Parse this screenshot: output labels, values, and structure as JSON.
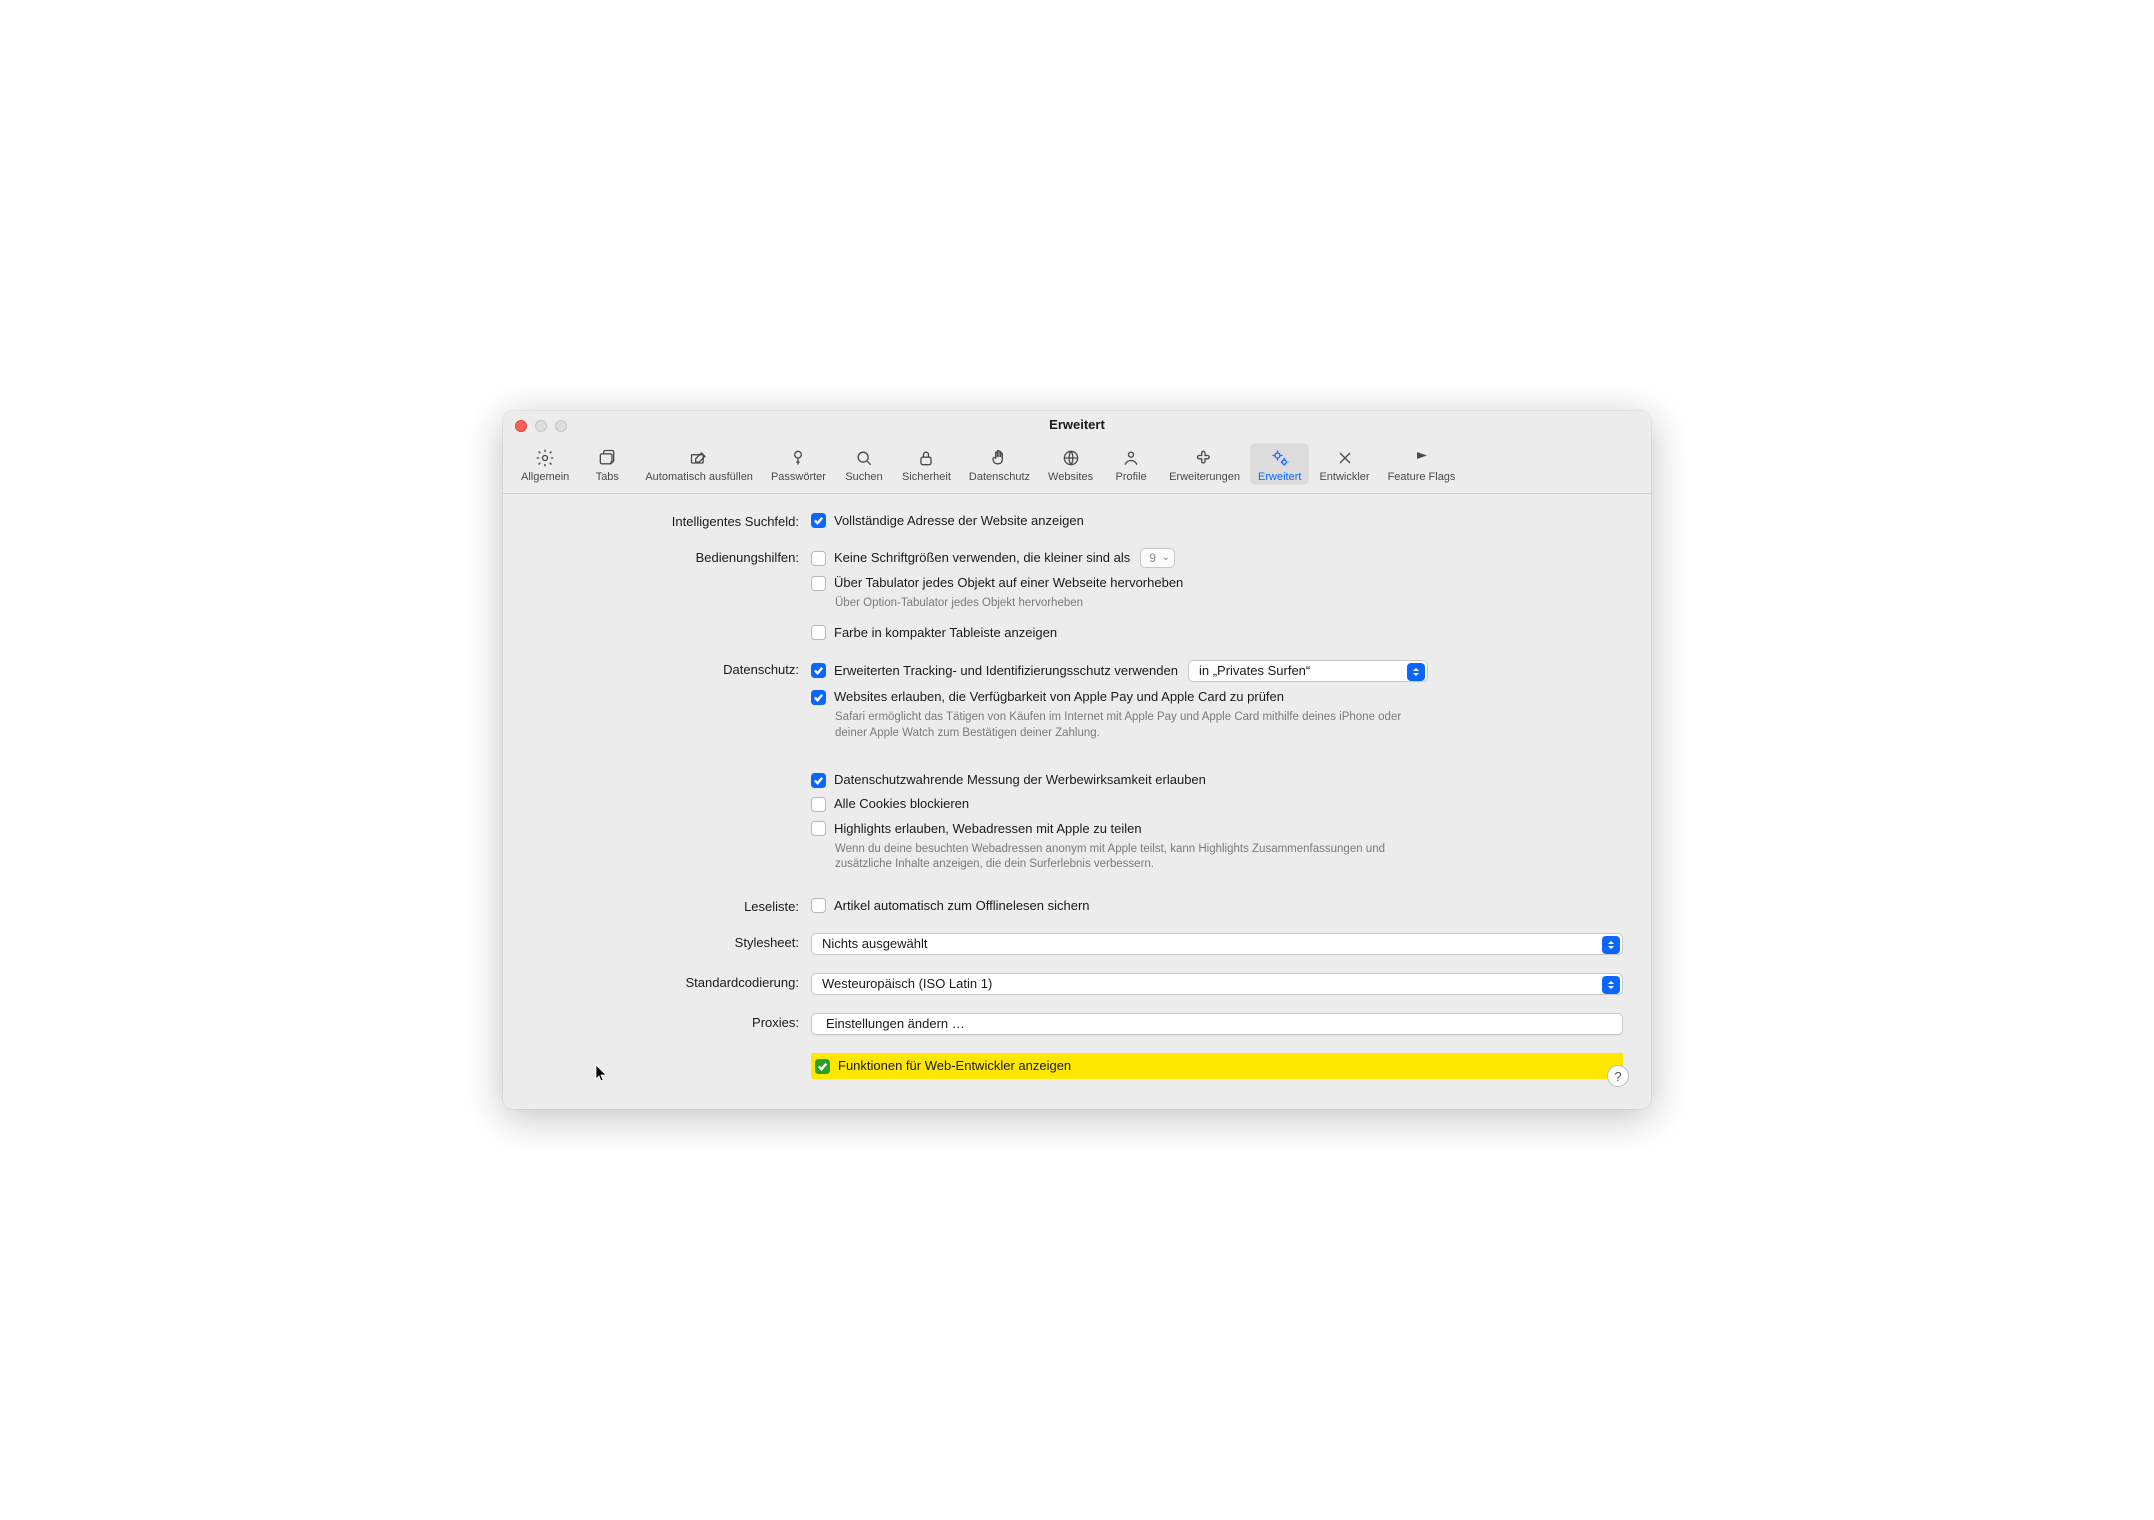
{
  "window": {
    "title": "Erweitert"
  },
  "toolbar": {
    "items": [
      {
        "id": "general",
        "label": "Allgemein"
      },
      {
        "id": "tabs",
        "label": "Tabs"
      },
      {
        "id": "autofill",
        "label": "Automatisch ausfüllen"
      },
      {
        "id": "passwords",
        "label": "Passwörter"
      },
      {
        "id": "search",
        "label": "Suchen"
      },
      {
        "id": "security",
        "label": "Sicherheit"
      },
      {
        "id": "privacy",
        "label": "Datenschutz"
      },
      {
        "id": "websites",
        "label": "Websites"
      },
      {
        "id": "profiles",
        "label": "Profile"
      },
      {
        "id": "extensions",
        "label": "Erweiterungen"
      },
      {
        "id": "advanced",
        "label": "Erweitert",
        "active": true
      },
      {
        "id": "developer",
        "label": "Entwickler"
      },
      {
        "id": "flags",
        "label": "Feature Flags"
      }
    ]
  },
  "sections": {
    "smartSearch": {
      "label": "Intelligentes Suchfeld:",
      "showFullAddress": {
        "checked": true,
        "text": "Vollständige Adresse der Website anzeigen"
      }
    },
    "accessibility": {
      "label": "Bedienungshilfen:",
      "noSmallFonts": {
        "checked": false,
        "text": "Keine Schriftgrößen verwenden, die kleiner sind als",
        "value": "9"
      },
      "tabHighlight": {
        "checked": false,
        "text": "Über Tabulator jedes Objekt auf einer Webseite hervorheben"
      },
      "tabHighlightHint": "Über Option-Tabulator jedes Objekt hervorheben",
      "compactColor": {
        "checked": false,
        "text": "Farbe in kompakter Tableiste anzeigen"
      }
    },
    "privacy": {
      "label": "Datenschutz:",
      "advancedTracking": {
        "checked": true,
        "text": "Erweiterten Tracking- und Identifizierungsschutz verwenden",
        "popup": "in „Privates Surfen“"
      },
      "applePay": {
        "checked": true,
        "text": "Websites erlauben, die Verfügbarkeit von Apple Pay und Apple Card zu prüfen"
      },
      "applePayHint": "Safari ermöglicht das Tätigen von Käufen im Internet mit Apple Pay und Apple Card mithilfe deines iPhone oder deiner Apple Watch zum Bestätigen deiner Zahlung.",
      "adMeasurement": {
        "checked": true,
        "text": "Datenschutzwahrende Messung der Werbewirksamkeit erlauben"
      },
      "blockCookies": {
        "checked": false,
        "text": "Alle Cookies blockieren"
      },
      "highlights": {
        "checked": false,
        "text": "Highlights erlauben, Webadressen mit Apple zu teilen"
      },
      "highlightsHint": "Wenn du deine besuchten Webadressen anonym mit Apple teilst, kann Highlights Zusammenfassungen und zusätzliche Inhalte anzeigen, die dein Surferlebnis verbessern."
    },
    "readingList": {
      "label": "Leseliste:",
      "saveOffline": {
        "checked": false,
        "text": "Artikel automatisch zum Offlinelesen sichern"
      }
    },
    "stylesheet": {
      "label": "Stylesheet:",
      "value": "Nichts ausgewählt"
    },
    "encoding": {
      "label": "Standardcodierung:",
      "value": "Westeuropäisch (ISO Latin 1)"
    },
    "proxies": {
      "label": "Proxies:",
      "button": "Einstellungen ändern …"
    },
    "devFeatures": {
      "checked": true,
      "text": "Funktionen für Web-Entwickler anzeigen"
    }
  },
  "help": "?"
}
